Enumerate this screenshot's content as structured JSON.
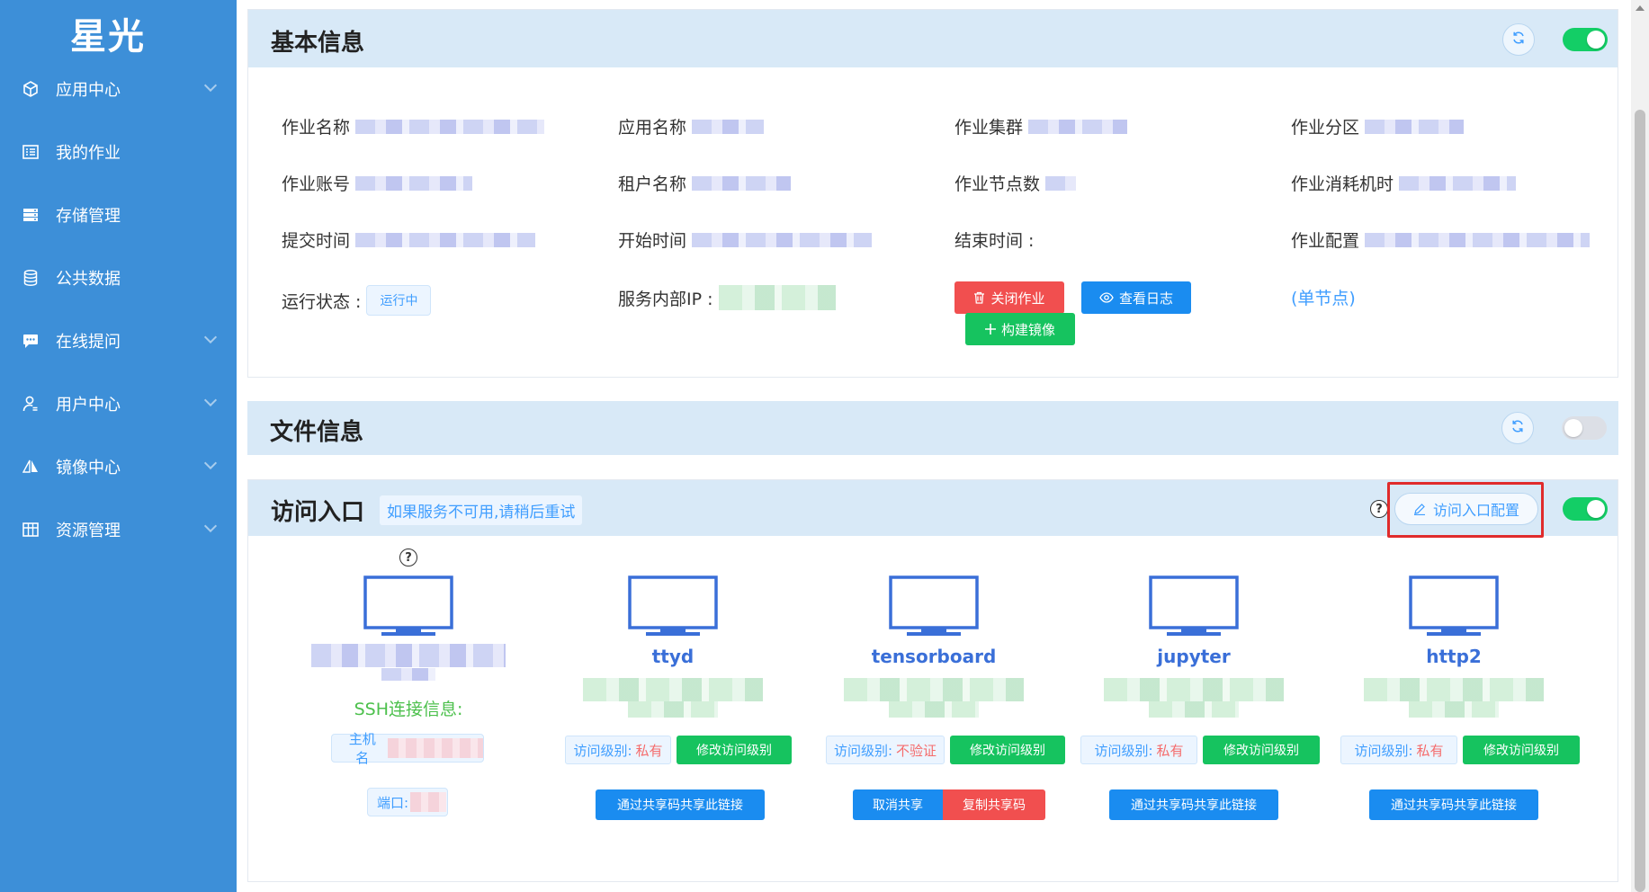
{
  "sidebar": {
    "logo": "星光",
    "items": [
      {
        "label": "应用中心",
        "icon": "cube-icon",
        "has_chevron": true
      },
      {
        "label": "我的作业",
        "icon": "list-icon",
        "has_chevron": false
      },
      {
        "label": "存储管理",
        "icon": "storage-icon",
        "has_chevron": false
      },
      {
        "label": "公共数据",
        "icon": "database-icon",
        "has_chevron": false
      },
      {
        "label": "在线提问",
        "icon": "chat-icon",
        "has_chevron": true
      },
      {
        "label": "用户中心",
        "icon": "user-icon",
        "has_chevron": true
      },
      {
        "label": "镜像中心",
        "icon": "mirror-icon",
        "has_chevron": true
      },
      {
        "label": "资源管理",
        "icon": "grid-icon",
        "has_chevron": true
      }
    ]
  },
  "basic_info": {
    "title": "基本信息",
    "toggle_on": true,
    "fields": {
      "job_name": "作业名称",
      "app_name": "应用名称",
      "cluster": "作业集群",
      "partition": "作业分区",
      "account": "作业账号",
      "tenant": "租户名称",
      "node_count": "作业节点数",
      "machine_time": "作业消耗机时",
      "submit_time": "提交时间",
      "start_time": "开始时间",
      "end_time": "结束时间 :",
      "job_config": "作业配置",
      "run_status": "运行状态 :",
      "internal_ip": "服务内部IP :"
    },
    "status_tag": "运行中",
    "buttons": {
      "close_job": "关闭作业",
      "view_log": "查看日志",
      "build_image": "构建镜像"
    },
    "single_node": "(单节点)"
  },
  "file_info": {
    "title": "文件信息",
    "toggle_on": false
  },
  "access": {
    "title": "访问入口",
    "hint": "如果服务不可用,请稍后重试",
    "config_button": "访问入口配置",
    "toggle_on": true,
    "ssh": {
      "label": "SSH连接信息:",
      "host_label": "主机名",
      "port_label": "端口:"
    },
    "entries": [
      {
        "name": "ttyd",
        "level_label": "访问级别:",
        "level_value": "私有",
        "modify_label": "修改访问级别",
        "share_label": "通过共享码共享此链接"
      },
      {
        "name": "tensorboard",
        "level_label": "访问级别:",
        "level_value": "不验证",
        "modify_label": "修改访问级别",
        "cancel_label": "取消共享",
        "copy_label": "复制共享码"
      },
      {
        "name": "jupyter",
        "level_label": "访问级别:",
        "level_value": "私有",
        "modify_label": "修改访问级别",
        "share_label": "通过共享码共享此链接"
      },
      {
        "name": "http2",
        "level_label": "访问级别:",
        "level_value": "私有",
        "modify_label": "修改访问级别",
        "share_label": "通过共享码共享此链接"
      }
    ]
  },
  "colors": {
    "sidebar": "#3d8fd8",
    "header": "#d8e9f7",
    "accent": "#409eff",
    "success": "#13ce66",
    "danger": "#f14f4f"
  }
}
